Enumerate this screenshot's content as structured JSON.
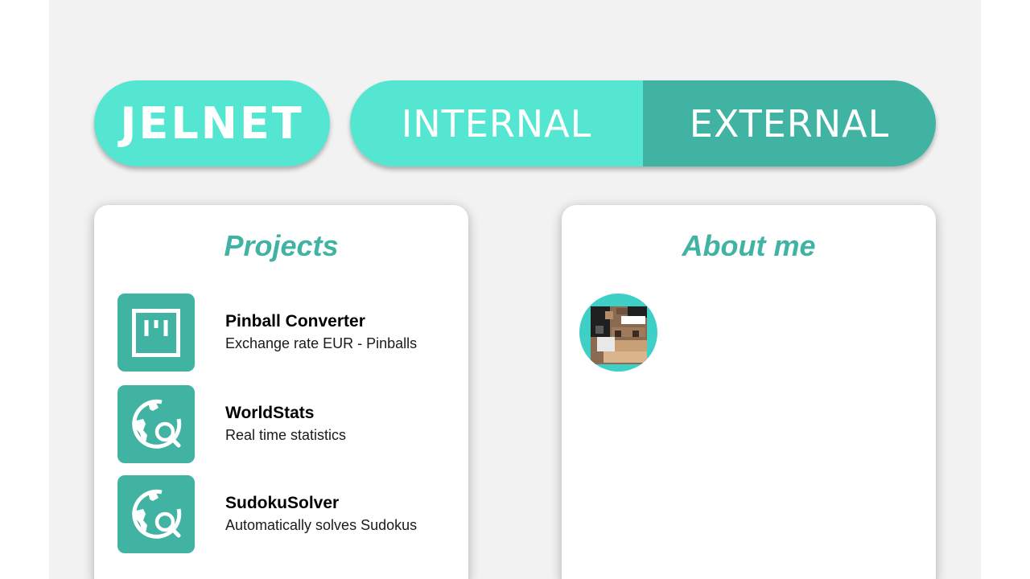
{
  "header": {
    "logo": "JELNET",
    "tabs": [
      {
        "label": "INTERNAL"
      },
      {
        "label": "EXTERNAL"
      }
    ]
  },
  "projects": {
    "title": "Projects",
    "items": [
      {
        "name": "Pinball Converter",
        "description": "Exchange rate EUR - Pinballs",
        "icon": "board-icon"
      },
      {
        "name": "WorldStats",
        "description": "Real time statistics",
        "icon": "globe-search-icon"
      },
      {
        "name": "SudokuSolver",
        "description": "Automatically solves Sudokus",
        "icon": "globe-search-icon"
      }
    ]
  },
  "about": {
    "title": "About me",
    "avatar": "pixel-avatar"
  },
  "colors": {
    "accent_light": "#55e6d2",
    "accent_dark": "#40b3a2",
    "background": "#f2f2f2"
  }
}
